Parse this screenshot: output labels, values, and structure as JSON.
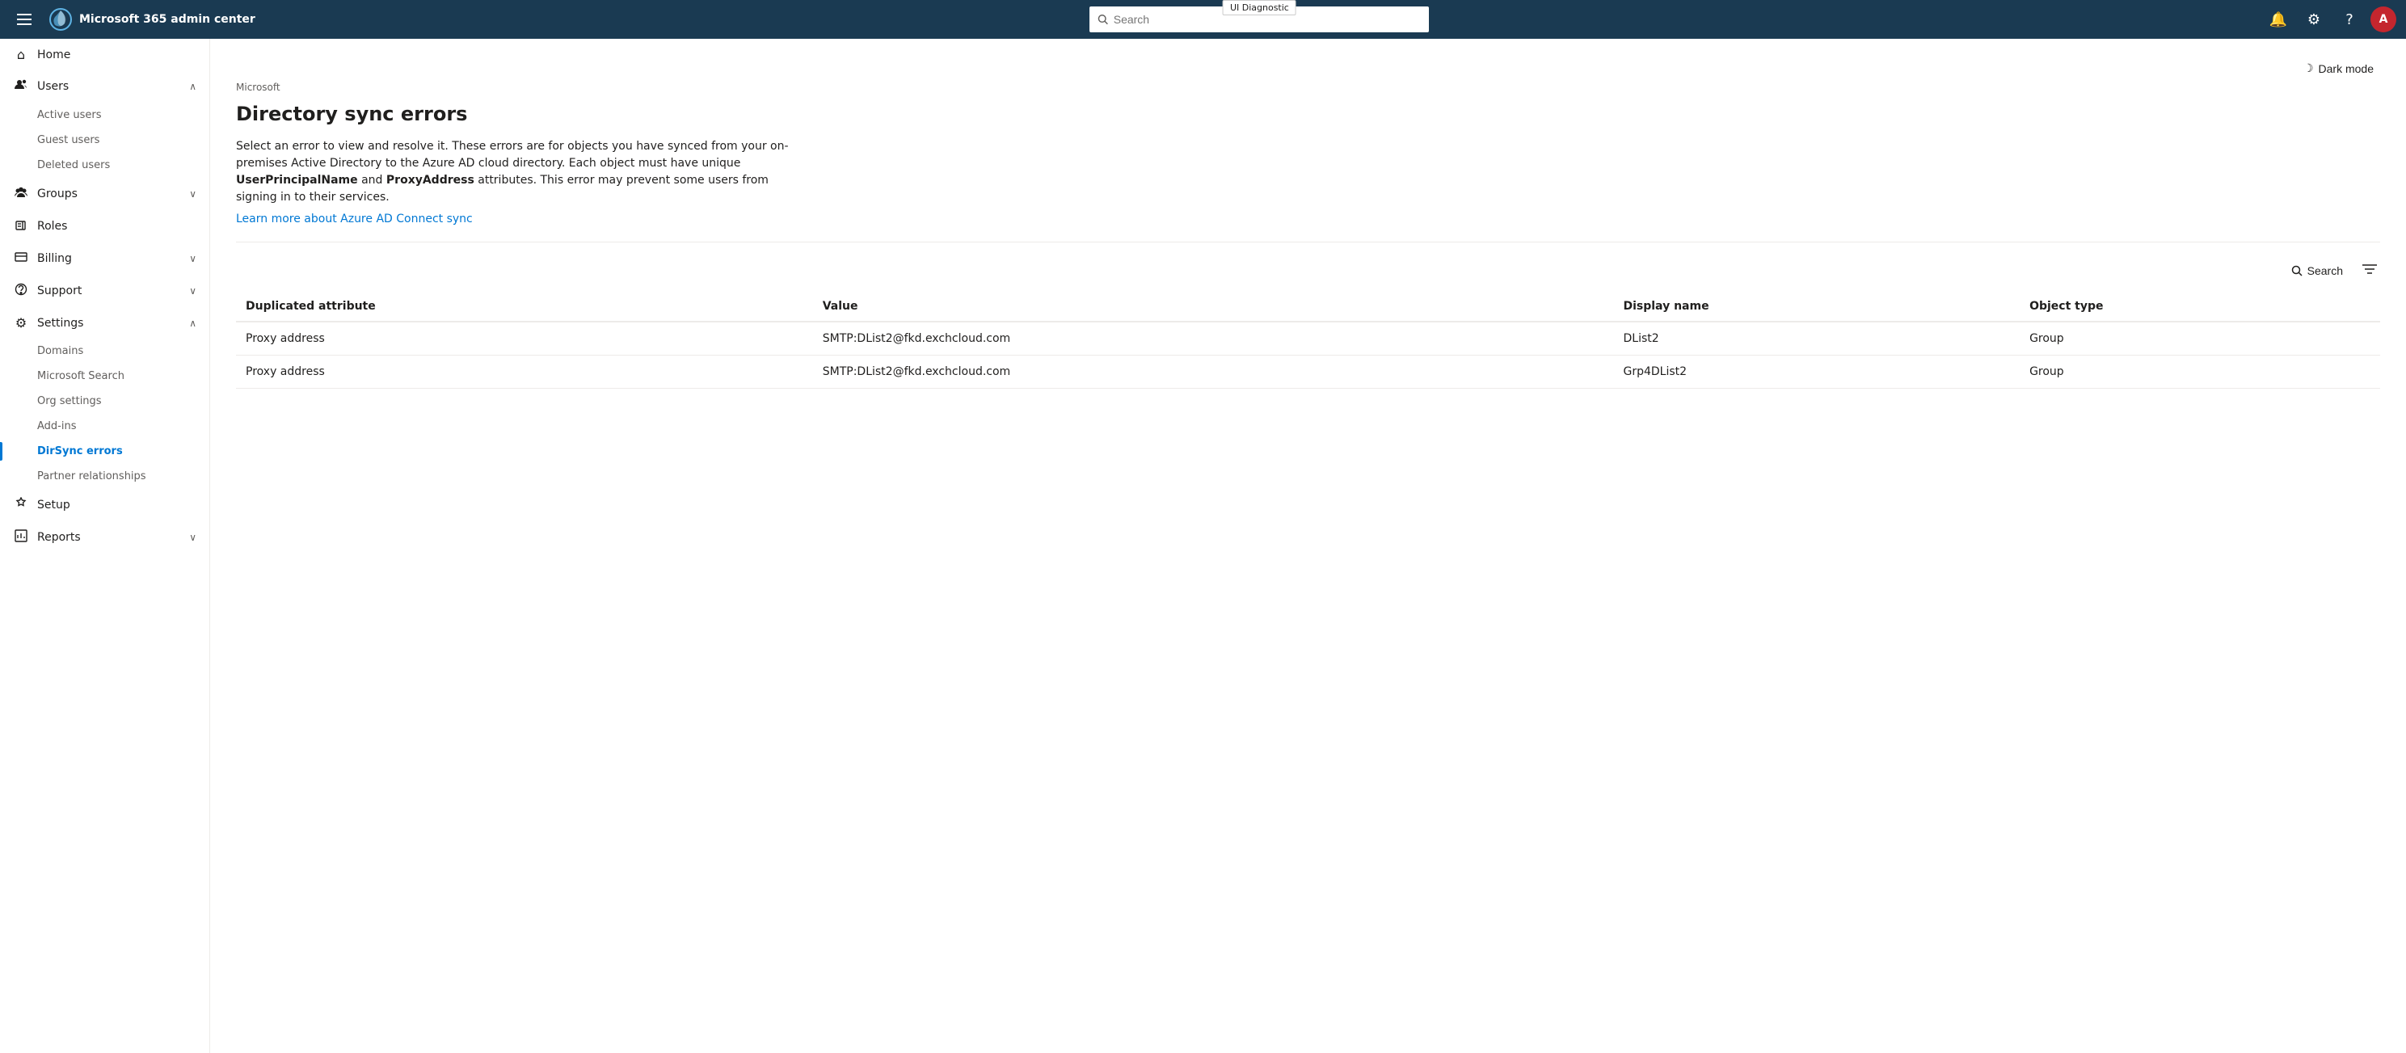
{
  "topnav": {
    "title": "Microsoft 365 admin center",
    "search_placeholder": "Search",
    "ui_diagnostic_label": "UI Diagnostic",
    "avatar_initial": "A"
  },
  "sidebar": {
    "hamburger_label": "Toggle navigation",
    "items": [
      {
        "id": "home",
        "label": "Home",
        "icon": "⌂",
        "expandable": false
      },
      {
        "id": "users",
        "label": "Users",
        "icon": "👤",
        "expandable": true,
        "expanded": true,
        "children": [
          {
            "id": "active-users",
            "label": "Active users"
          },
          {
            "id": "guest-users",
            "label": "Guest users"
          },
          {
            "id": "deleted-users",
            "label": "Deleted users"
          }
        ]
      },
      {
        "id": "groups",
        "label": "Groups",
        "icon": "👥",
        "expandable": true,
        "expanded": false
      },
      {
        "id": "roles",
        "label": "Roles",
        "icon": "🔑",
        "expandable": false
      },
      {
        "id": "billing",
        "label": "Billing",
        "icon": "🧾",
        "expandable": true,
        "expanded": false
      },
      {
        "id": "support",
        "label": "Support",
        "icon": "🔧",
        "expandable": true,
        "expanded": false
      },
      {
        "id": "settings",
        "label": "Settings",
        "icon": "⚙",
        "expandable": true,
        "expanded": true,
        "children": [
          {
            "id": "domains",
            "label": "Domains"
          },
          {
            "id": "microsoft-search",
            "label": "Microsoft Search"
          },
          {
            "id": "org-settings",
            "label": "Org settings"
          },
          {
            "id": "add-ins",
            "label": "Add-ins"
          },
          {
            "id": "dirsync-errors",
            "label": "DirSync errors",
            "active": true
          },
          {
            "id": "partner-relationships",
            "label": "Partner relationships"
          }
        ]
      },
      {
        "id": "setup",
        "label": "Setup",
        "icon": "🔨",
        "expandable": false
      },
      {
        "id": "reports",
        "label": "Reports",
        "icon": "📊",
        "expandable": true,
        "expanded": false
      }
    ]
  },
  "main": {
    "breadcrumb": "Microsoft",
    "dark_mode_label": "Dark mode",
    "page_title": "Directory sync errors",
    "description_text": "Select an error to view and resolve it. These errors are for objects you have synced from your on-premises Active Directory to the Azure AD cloud directory. Each object must have unique ",
    "description_bold1": "UserPrincipalName",
    "description_and": " and ",
    "description_bold2": "ProxyAddress",
    "description_end": " attributes. This error may prevent some users from signing in to their services.",
    "learn_link_text": "Learn more about Azure AD Connect sync",
    "search_label": "Search",
    "table": {
      "columns": [
        {
          "id": "duplicated-attribute",
          "label": "Duplicated attribute"
        },
        {
          "id": "value",
          "label": "Value"
        },
        {
          "id": "display-name",
          "label": "Display name"
        },
        {
          "id": "object-type",
          "label": "Object type"
        }
      ],
      "rows": [
        {
          "duplicated_attribute": "Proxy address",
          "value": "SMTP:DList2@fkd.exchcloud.com",
          "display_name": "DList2",
          "object_type": "Group"
        },
        {
          "duplicated_attribute": "Proxy address",
          "value": "SMTP:DList2@fkd.exchcloud.com",
          "display_name": "Grp4DList2",
          "object_type": "Group"
        }
      ]
    }
  }
}
